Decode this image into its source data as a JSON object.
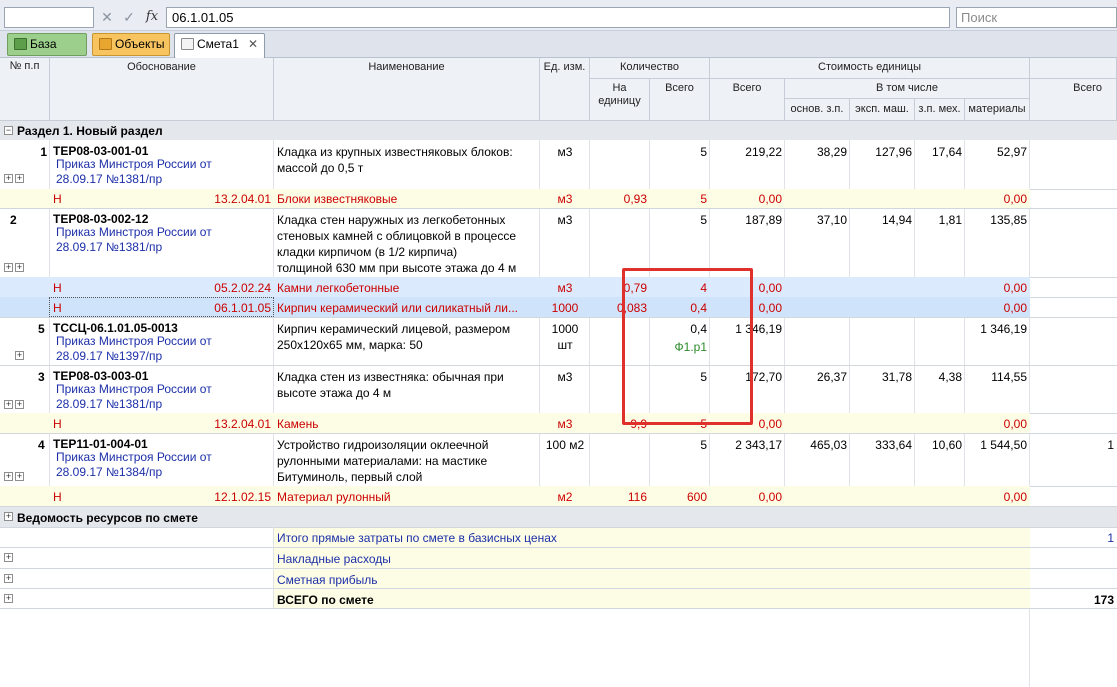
{
  "toolbar": {
    "formula_value": "06.1.01.05",
    "search_placeholder": "Поиск"
  },
  "tabs": [
    {
      "label": "База"
    },
    {
      "label": "Объекты"
    },
    {
      "label": "Смета1"
    }
  ],
  "header": {
    "num": "№ п.п",
    "basis": "Обоснование",
    "name": "Наименование",
    "unit": "Ед. изм.",
    "qty": "Количество",
    "qty_per_unit": "На единицу",
    "qty_total": "Всего",
    "unit_cost": "Стоимость единицы",
    "cost_total": "Всего",
    "including": "В том числе",
    "osn_zp": "основ. з.п.",
    "eksp_mash": "эксп. маш.",
    "zp_meh": "з.п. мех.",
    "materials": "материалы",
    "grand_total": "Всего"
  },
  "section1": {
    "label": "Раздел 1. Новый раздел"
  },
  "rows": {
    "r1": {
      "num": "1",
      "code": "ТЕР08-03-001-01",
      "order1": "Приказ Минстроя России от",
      "order2": "28.09.17 №1381/пр",
      "name1": "Кладка из крупных известняковых блоков:",
      "name2": "массой до 0,5 т",
      "unit": "м3",
      "total": "5",
      "cost": "219,22",
      "zp": "38,29",
      "mash": "127,96",
      "zpmeh": "17,64",
      "mat": "52,97"
    },
    "r1r": {
      "flag": "Н",
      "code": "13.2.04.01",
      "name": "Блоки известняковые",
      "unit": "м3",
      "per": "0,93",
      "total": "5",
      "cost": "0,00",
      "mat": "0,00"
    },
    "r2": {
      "num": "2",
      "code": "ТЕР08-03-002-12",
      "order1": "Приказ Минстроя России от",
      "order2": "28.09.17 №1381/пр",
      "name1": "Кладка стен наружных из легкобетонных",
      "name2": "стеновых камней с облицовкой в процессе",
      "name3": "кладки кирпичом (в 1/2 кирпича)",
      "name4": "толщиной 630 мм при высоте этажа до 4 м",
      "unit": "м3",
      "total": "5",
      "cost": "187,89",
      "zp": "37,10",
      "mash": "14,94",
      "zpmeh": "1,81",
      "mat": "135,85"
    },
    "r2a": {
      "flag": "Н",
      "code": "05.2.02.24",
      "name": "Камни легкобетонные",
      "unit": "м3",
      "per": "0,79",
      "total": "4",
      "cost": "0,00",
      "mat": "0,00"
    },
    "r2b": {
      "flag": "Н",
      "code": "06.1.01.05",
      "name": "Кирпич керамический или силикатный ли...",
      "unit": "1000",
      "per": "0,083",
      "total": "0,4",
      "cost": "0,00",
      "mat": "0,00"
    },
    "r5": {
      "num": "5",
      "code": "ТССЦ-06.1.01.05-0013",
      "order1": "Приказ Минстроя России от",
      "order2": "28.09.17 №1397/пр",
      "name1": "Кирпич керамический лицевой, размером",
      "name2": "250х120х65 мм, марка: 50",
      "unit1": "1000",
      "unit2": "шт",
      "total": "0,4",
      "formula": "Ф1.р1",
      "cost": "1 346,19",
      "mat": "1 346,19"
    },
    "r3": {
      "num": "3",
      "code": "ТЕР08-03-003-01",
      "order1": "Приказ Минстроя России от",
      "order2": "28.09.17 №1381/пр",
      "name1": "Кладка стен из известняка: обычная при",
      "name2": "высоте этажа до 4 м",
      "unit": "м3",
      "total": "5",
      "cost": "172,70",
      "zp": "26,37",
      "mash": "31,78",
      "zpmeh": "4,38",
      "mat": "114,55"
    },
    "r3r": {
      "flag": "Н",
      "code": "13.2.04.01",
      "name": "Камень",
      "unit": "м3",
      "per": "9,9",
      "total": "5",
      "cost": "0,00",
      "mat": "0,00"
    },
    "r4": {
      "num": "4",
      "code": "ТЕР11-01-004-01",
      "order1": "Приказ Минстроя России от",
      "order2": "28.09.17 №1384/пр",
      "name1": "Устройство гидроизоляции оклеечной",
      "name2": "рулонными материалами: на мастике",
      "name3": "Битуминоль, первый слой",
      "unit": "100 м2",
      "total": "5",
      "cost": "2 343,17",
      "zp": "465,03",
      "mash": "333,64",
      "zpmeh": "10,60",
      "mat": "1 544,50",
      "grand": "1"
    },
    "r4r": {
      "flag": "Н",
      "code": "12.1.02.15",
      "name": "Материал рулонный",
      "unit": "м2",
      "per": "116",
      "total": "600",
      "cost": "0,00",
      "mat": "0,00"
    }
  },
  "resources": {
    "label": "Ведомость ресурсов по смете"
  },
  "summary": {
    "direct": "Итого прямые затраты по смете в базисных ценах",
    "direct_val": "1",
    "overhead": "Накладные расходы",
    "profit": "Сметная прибыль",
    "total": "ВСЕГО по смете",
    "total_val": "173"
  },
  "colors": {
    "red": "#cc0000",
    "blue": "#1c2fa8",
    "highlight": "#cfe3fb",
    "summary_bg": "#fdfde6",
    "annotation": "#e0302b"
  }
}
